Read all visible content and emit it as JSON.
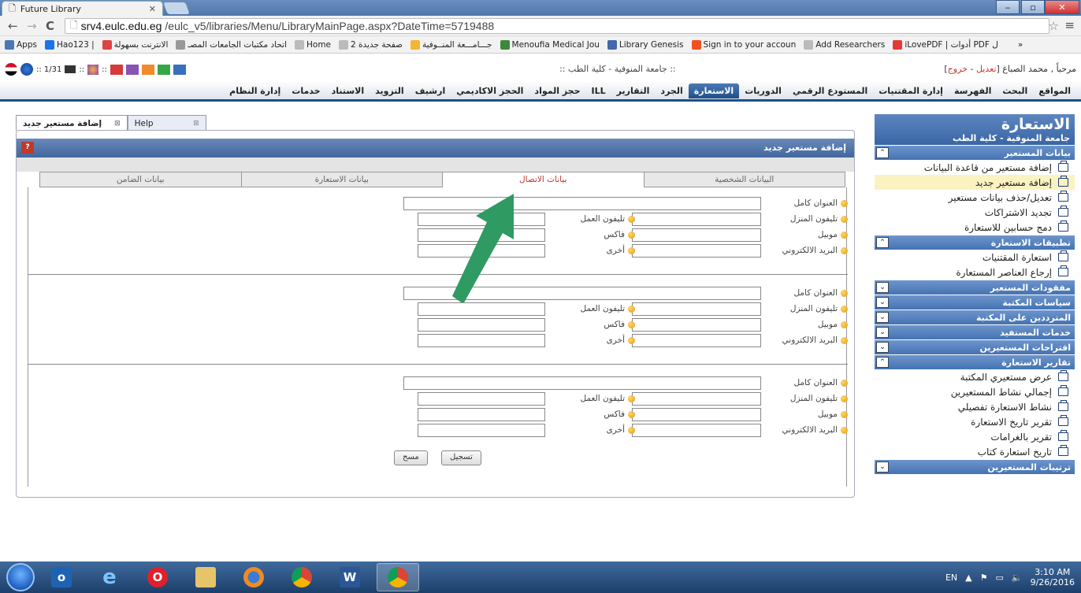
{
  "browser": {
    "tab_title": "Future Library",
    "url_host": "srv4.eulc.edu.eg",
    "url_path": "/eulc_v5/libraries/Menu/LibraryMainPage.aspx?DateTime=5719488",
    "bookmarks": [
      {
        "label": "Apps",
        "color": "#4a79b6"
      },
      {
        "label": "Hao123 | ",
        "color": "#1a73e8"
      },
      {
        "label": "الانترنت بسهولة",
        "color": "#d44"
      },
      {
        "label": "اتحاد مكتبات الجامعات المصـ",
        "color": "#999"
      },
      {
        "label": "Home",
        "color": "#bbb"
      },
      {
        "label": "صفحة جديدة 2",
        "color": "#bbb"
      },
      {
        "label": "جـــامـــعة المنــوفية",
        "color": "#f2b630"
      },
      {
        "label": "Menoufia Medical Jou",
        "color": "#3a8a3a"
      },
      {
        "label": "Library Genesis",
        "color": "#4466aa"
      },
      {
        "label": "Sign in to your accoun",
        "color": "#f25022"
      },
      {
        "label": "Add Researchers",
        "color": "#bbb"
      },
      {
        "label": "iLovePDF | أدوات PDF ل",
        "color": "#e53935"
      },
      {
        "label": "»",
        "color": "transparent"
      }
    ]
  },
  "infobar": {
    "counter": ":: 1/31",
    "center_title": ":: جامعة المنوفية - كلية الطب ::",
    "welcome": "مرحباً , محمد الصباغ [",
    "edit_link": "تعديل",
    "sep": " - ",
    "logout_link": "خروج",
    "close_bracket": "]"
  },
  "mainnav": [
    "المواقع",
    "البحث",
    "الفهرسة",
    "إدارة المقتنيات",
    "المستودع الرقمي",
    "الدوريات",
    "الاستعارة",
    "الجرد",
    "التقارير",
    "ILL",
    "حجز المواد",
    "الحجز الاكاديمي",
    "ارشيف",
    "التزويد",
    "الاستناد",
    "خدمات",
    "إدارة النظام"
  ],
  "mainnav_active": "الاستعارة",
  "sidebar": {
    "title": "الاستعارة",
    "subtitle": "جامعة المنوفية - كلية الطب",
    "sections": [
      {
        "label": "بيانات المستعير",
        "expanded": true,
        "items": [
          "إضافة مستعير من قاعدة البيانات",
          "إضافة مستعير جديد",
          "تعديل/حذف بيانات مستعير",
          "تجديد الاشتراكات",
          "دمج حسابين للاستعارة"
        ],
        "selected": 1
      },
      {
        "label": "تطبيقات الاستعارة",
        "expanded": true,
        "items": [
          "استعارة المقتنيات",
          "إرجاع العناصر المستعارة"
        ],
        "selected": -1
      },
      {
        "label": "مفقودات المستعير",
        "expanded": false,
        "items": [],
        "selected": -1
      },
      {
        "label": "سياسات المكتبة",
        "expanded": false,
        "items": [],
        "selected": -1
      },
      {
        "label": "المترددين على المكتبة",
        "expanded": false,
        "items": [],
        "selected": -1
      },
      {
        "label": "خدمات المستفيد",
        "expanded": false,
        "items": [],
        "selected": -1
      },
      {
        "label": "اقتراحات المستعيرين",
        "expanded": false,
        "items": [],
        "selected": -1
      },
      {
        "label": "تقارير الاستعارة",
        "expanded": true,
        "items": [
          "عرض مستعيري المكتبة",
          "إجمالي نشاط المستعيرين",
          "نشاط الاستعارة تفصيلي",
          "تقرير تاريخ الاستعارة",
          "تقرير بالغرامات",
          "تاريخ استعارة كتاب"
        ],
        "selected": -1
      },
      {
        "label": "ترتيبات المستعيرين",
        "expanded": false,
        "items": [],
        "selected": -1
      }
    ]
  },
  "content_tabs": [
    {
      "label": "إضافة مستعير جديد",
      "active": true
    },
    {
      "label": "Help",
      "active": false
    }
  ],
  "panel": {
    "title": "إضافة مستعير جديد",
    "form_tabs": [
      "البيانات الشخصية",
      "بيانات الاتصال",
      "بيانات الاستعارة",
      "بيانات الضامن"
    ],
    "active_form_tab": "بيانات الاتصال",
    "fields": {
      "full_address": "العنوان كامل",
      "home_phone": "تليفون المنزل",
      "work_phone": "تليفون العمل",
      "mobile": "موبيل",
      "fax": "فاكس",
      "email": "البريد الالكتروني",
      "other": "أخرى"
    },
    "save_button": "تسجيل",
    "clear_button": "مسح"
  },
  "taskbar": {
    "lang": "EN",
    "time": "3:10 AM",
    "date": "9/26/2016"
  }
}
